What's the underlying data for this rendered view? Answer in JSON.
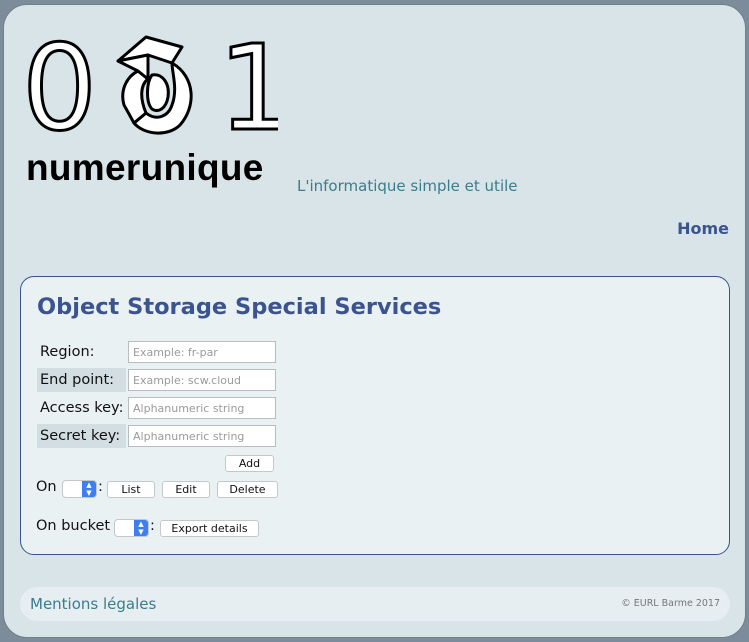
{
  "header": {
    "logo_digits": [
      "0",
      "1"
    ],
    "brand_name": "numerunique",
    "tagline": "L'informatique simple et utile",
    "nav": {
      "home": "Home"
    }
  },
  "main": {
    "title": "Object Storage Special Services",
    "form": {
      "fields": [
        {
          "label": "Region:",
          "placeholder": "Example: fr-par",
          "value": ""
        },
        {
          "label": "End point:",
          "placeholder": "Example: scw.cloud",
          "value": ""
        },
        {
          "label": "Access key:",
          "placeholder": "Alphanumeric string",
          "value": ""
        },
        {
          "label": "Secret key:",
          "placeholder": "Alphanumeric string",
          "value": ""
        }
      ],
      "add_label": "Add"
    },
    "on_row": {
      "label": "On",
      "separator": ":",
      "selected": "",
      "buttons": {
        "list": "List",
        "edit": "Edit",
        "delete": "Delete"
      }
    },
    "bucket_row": {
      "label": "On bucket",
      "separator": ":",
      "selected": "",
      "export_label": "Export details"
    }
  },
  "footer": {
    "legal_link": "Mentions légales",
    "copyright": "© EURL Barme 2017"
  },
  "colors": {
    "accent": "#3b5490",
    "teal": "#3a7d8c",
    "page_bg": "#d8e4e8",
    "panel_bg": "#e9f1f3",
    "select_blue": "#3d7ef0"
  }
}
